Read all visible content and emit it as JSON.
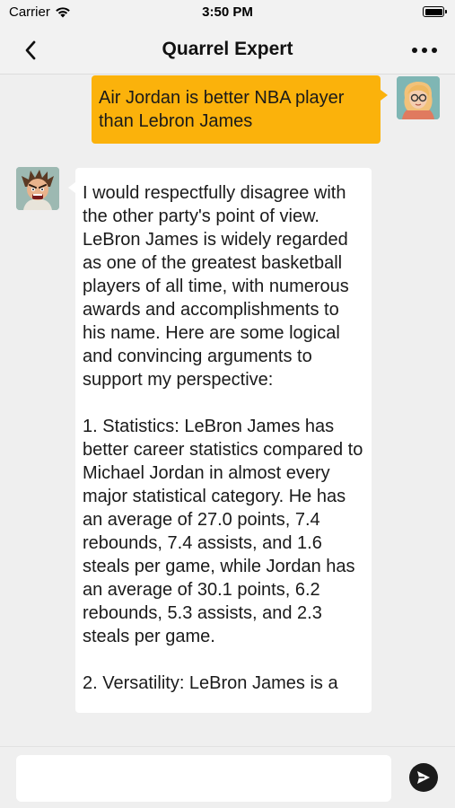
{
  "status_bar": {
    "carrier": "Carrier",
    "time": "3:50 PM"
  },
  "nav": {
    "title": "Quarrel Expert",
    "back_icon": "chevron-left-icon",
    "more_icon": "ellipsis-icon"
  },
  "messages": [
    {
      "sender": "user",
      "text": "Air Jordan is better NBA player than Lebron James"
    },
    {
      "sender": "bot",
      "text": "I would respectfully disagree with the other party's point of view. LeBron James is widely regarded as one of the greatest basketball players of all time, with numerous awards and accomplishments to his name. Here are some logical and convincing arguments to support my perspective:\n\n1. Statistics: LeBron James has better career statistics compared to Michael Jordan in almost every major statistical category. He has an average of 27.0 points, 7.4 rebounds, 7.4 assists, and 1.6 steals per game, while Jordan has an average of 30.1 points, 6.2 rebounds, 5.3 assists, and 2.3 steals per game.\n\n2. Versatility: LeBron James is a"
    }
  ],
  "input": {
    "value": "",
    "placeholder": ""
  },
  "colors": {
    "user_bubble": "#fbb20b",
    "bot_bubble": "#ffffff",
    "background": "#efefef"
  }
}
